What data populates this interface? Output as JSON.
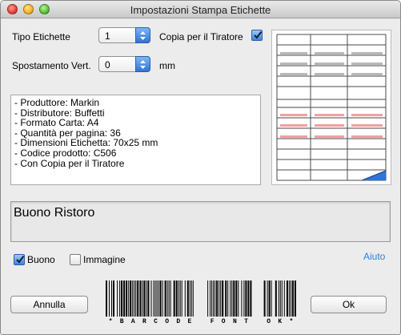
{
  "window": {
    "title": "Impostazioni Stampa Etichette"
  },
  "form": {
    "tipo_label": "Tipo Etichette",
    "tipo_value": "1",
    "copia_label": "Copia per il Tiratore",
    "copia_checked": true,
    "spostamento_label": "Spostamento Vert.",
    "spostamento_value": "0",
    "spostamento_unit": "mm"
  },
  "info": {
    "lines": [
      "- Produttore: Markin",
      "- Distributore: Buffetti",
      "- Formato Carta: A4",
      "- Quantità per pagina: 36",
      "- Dimensioni Etichetta: 70x25 mm",
      "- Codice prodotto: C506",
      "- Con Copia per il Tiratore"
    ]
  },
  "name_field": {
    "value": "Buono Ristoro"
  },
  "options": {
    "buono_label": "Buono",
    "buono_checked": true,
    "immagine_label": "Immagine",
    "immagine_checked": false,
    "help_label": "Aiuto"
  },
  "buttons": {
    "cancel": "Annulla",
    "ok": "Ok"
  },
  "barcode": {
    "text": "*BARCODE FONT OK*"
  },
  "colors": {
    "accent_blue": "#2f74d6",
    "gray_stripe": "#b8b8b8",
    "red_stripe": "#f0a0a0",
    "help_link": "#2d7fd8"
  }
}
